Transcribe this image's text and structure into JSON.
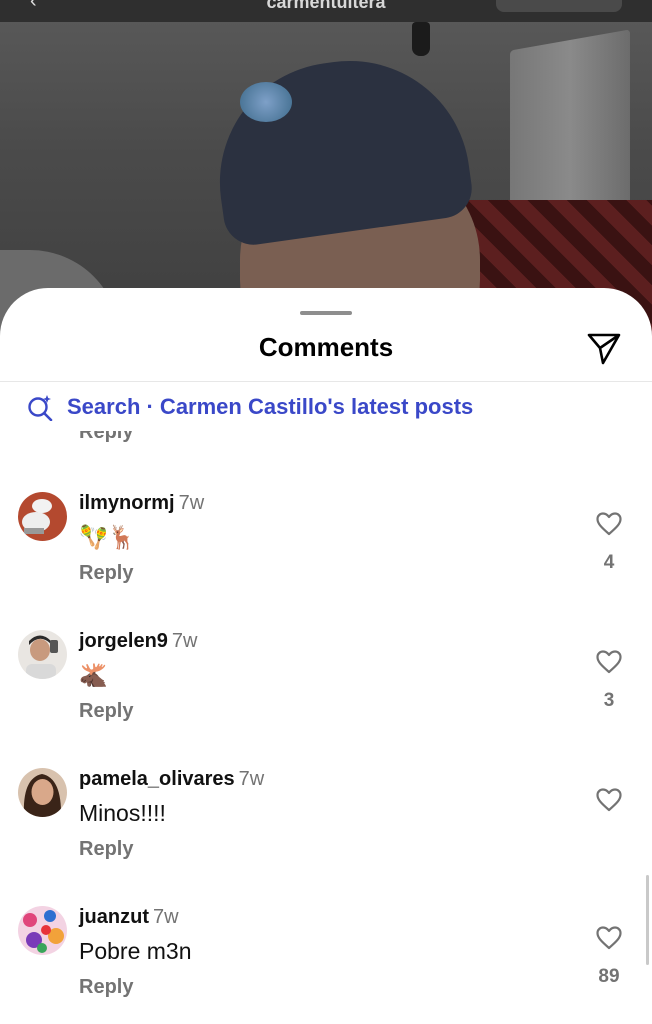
{
  "post": {
    "username": "carmentultera"
  },
  "sheet": {
    "title": "Comments",
    "search_text": "Search · Carmen Castillo's latest posts",
    "partial_reply_label": "Reply"
  },
  "comments": [
    {
      "username": "ilmynormj",
      "time": "7w",
      "text": "🪇🦌",
      "reply_label": "Reply",
      "likes": "4"
    },
    {
      "username": "jorgelen9",
      "time": "7w",
      "text": "🫎",
      "reply_label": "Reply",
      "likes": "3"
    },
    {
      "username": "pamela_olivares",
      "time": "7w",
      "text": "Minos!!!!",
      "reply_label": "Reply",
      "likes": ""
    },
    {
      "username": "juanzut",
      "time": "7w",
      "text": "Pobre m3n",
      "reply_label": "Reply",
      "likes": "89"
    }
  ],
  "colors": {
    "link_blue": "#3a48c8",
    "muted_gray": "#737373"
  }
}
